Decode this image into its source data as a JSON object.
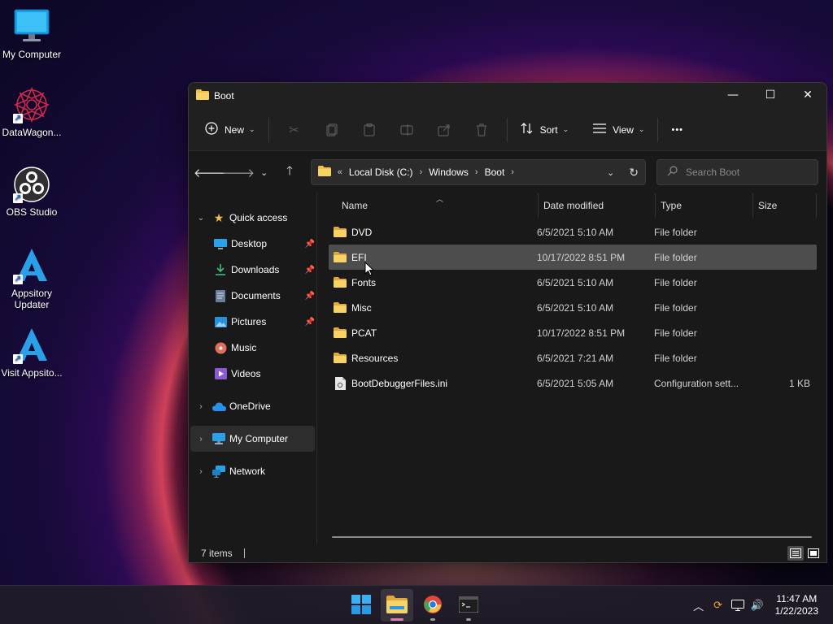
{
  "desktop": {
    "icons": [
      {
        "label": "My Computer",
        "icon": "monitor-icon"
      },
      {
        "label": "DataWagon...",
        "icon": "datawagon-icon"
      },
      {
        "label": "OBS Studio",
        "icon": "obs-icon"
      },
      {
        "label": "Appsitory Updater",
        "icon": "appsitory-icon"
      },
      {
        "label": "Visit Appsito...",
        "icon": "appsitory-icon"
      }
    ]
  },
  "window": {
    "title": "Boot",
    "controls": {
      "minimize": "—",
      "maximize": "☐",
      "close": "✕"
    }
  },
  "toolbar": {
    "new_label": "New",
    "sort_label": "Sort",
    "view_label": "View",
    "more_label": "•••"
  },
  "address": {
    "overflow": "«",
    "crumbs": [
      "Local Disk (C:)",
      "Windows",
      "Boot"
    ]
  },
  "search": {
    "placeholder": "Search Boot"
  },
  "nav": {
    "quick_access": "Quick access",
    "items": [
      {
        "label": "Desktop",
        "icon": "desktop-icon",
        "pinned": true
      },
      {
        "label": "Downloads",
        "icon": "downloads-icon",
        "pinned": true
      },
      {
        "label": "Documents",
        "icon": "documents-icon",
        "pinned": true
      },
      {
        "label": "Pictures",
        "icon": "pictures-icon",
        "pinned": true
      },
      {
        "label": "Music",
        "icon": "music-icon",
        "pinned": false
      },
      {
        "label": "Videos",
        "icon": "videos-icon",
        "pinned": false
      }
    ],
    "onedrive": "OneDrive",
    "my_computer": "My Computer",
    "network": "Network"
  },
  "columns": {
    "name": "Name",
    "date": "Date modified",
    "type": "Type",
    "size": "Size"
  },
  "files": [
    {
      "name": "DVD",
      "date": "6/5/2021 5:10 AM",
      "type": "File folder",
      "size": "",
      "kind": "folder"
    },
    {
      "name": "EFI",
      "date": "10/17/2022 8:51 PM",
      "type": "File folder",
      "size": "",
      "kind": "folder"
    },
    {
      "name": "Fonts",
      "date": "6/5/2021 5:10 AM",
      "type": "File folder",
      "size": "",
      "kind": "folder"
    },
    {
      "name": "Misc",
      "date": "6/5/2021 5:10 AM",
      "type": "File folder",
      "size": "",
      "kind": "folder"
    },
    {
      "name": "PCAT",
      "date": "10/17/2022 8:51 PM",
      "type": "File folder",
      "size": "",
      "kind": "folder"
    },
    {
      "name": "Resources",
      "date": "6/5/2021 7:21 AM",
      "type": "File folder",
      "size": "",
      "kind": "folder"
    },
    {
      "name": "BootDebuggerFiles.ini",
      "date": "6/5/2021 5:05 AM",
      "type": "Configuration sett...",
      "size": "1 KB",
      "kind": "ini"
    }
  ],
  "status": {
    "items": "7 items"
  },
  "taskbar": {
    "apps": [
      "start",
      "file-explorer",
      "chrome",
      "terminal"
    ],
    "time": "11:47 AM",
    "date": "1/22/2023"
  },
  "colors": {
    "folder": "#f2c04a",
    "accent": "#e07ab0",
    "selected_row": "#4d4d4d"
  }
}
